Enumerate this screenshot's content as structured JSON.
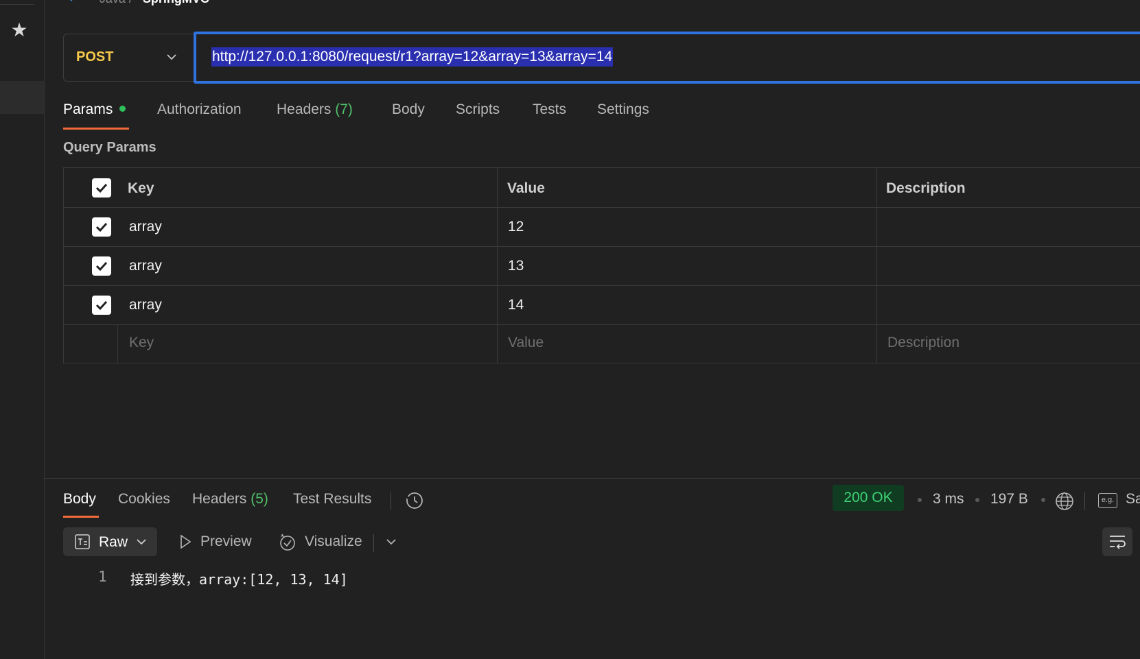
{
  "breadcrumb": {
    "parent": "Java",
    "separator": "/",
    "current": "SpringMVC"
  },
  "request": {
    "method": "POST",
    "url": "http://127.0.0.1:8080/request/r1?array=12&array=13&array=14"
  },
  "request_tabs": [
    {
      "label": "Params",
      "active": true
    },
    {
      "label": "Authorization"
    },
    {
      "label": "Headers",
      "count": "(7)"
    },
    {
      "label": "Body"
    },
    {
      "label": "Scripts"
    },
    {
      "label": "Tests"
    },
    {
      "label": "Settings"
    }
  ],
  "query_params": {
    "title": "Query Params",
    "headers": {
      "key": "Key",
      "value": "Value",
      "description": "Description"
    },
    "rows": [
      {
        "checked": true,
        "key": "array",
        "value": "12",
        "description": ""
      },
      {
        "checked": true,
        "key": "array",
        "value": "13",
        "description": ""
      },
      {
        "checked": true,
        "key": "array",
        "value": "14",
        "description": ""
      }
    ],
    "placeholders": {
      "key": "Key",
      "value": "Value",
      "description": "Description"
    }
  },
  "response": {
    "tabs": [
      {
        "label": "Body",
        "active": true
      },
      {
        "label": "Cookies"
      },
      {
        "label": "Headers",
        "count": "(5)"
      },
      {
        "label": "Test Results"
      }
    ],
    "status": "200 OK",
    "time": "3 ms",
    "size": "197 B",
    "save_label": "Sa",
    "eg_label": "e.g.",
    "view_mode": "Raw",
    "preview_label": "Preview",
    "visualize_label": "Visualize",
    "body_lines": [
      {
        "number": "1",
        "text": "接到参数，array:[12, 13, 14]"
      }
    ]
  },
  "colors": {
    "method": "#f5c94a",
    "accent_tab": "#f26b3a",
    "url_focus": "#2f73e0",
    "status_ok": "#3fd175",
    "count_green": "#4fc16a"
  }
}
